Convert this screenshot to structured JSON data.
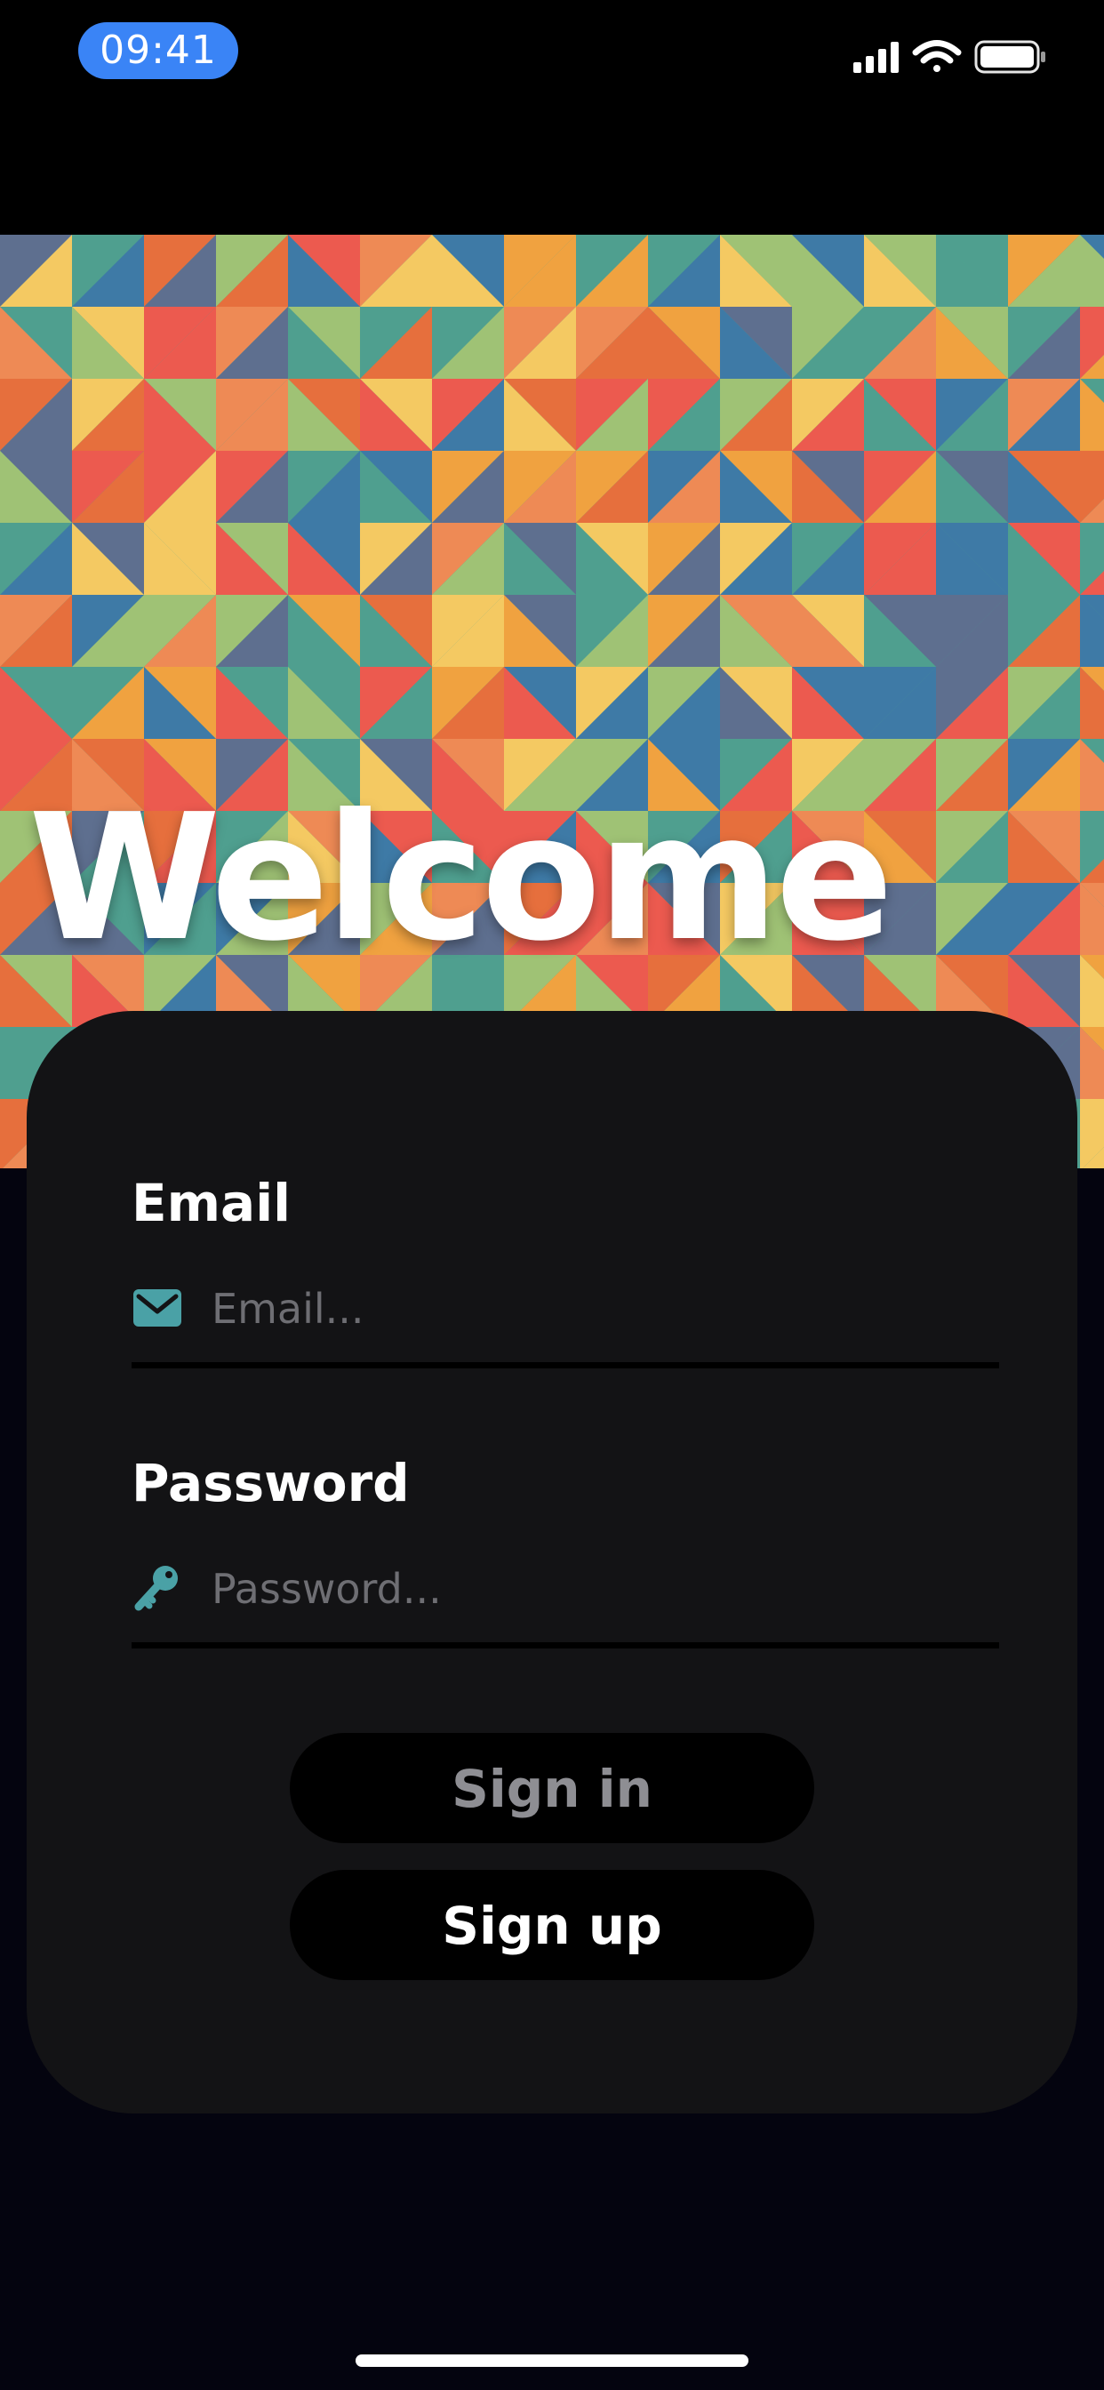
{
  "status_bar": {
    "time": "09:41",
    "icons": [
      "cellular-signal-icon",
      "wifi-icon",
      "battery-icon"
    ],
    "pill_color": "#3a84f6"
  },
  "hero": {
    "title": "Welcome",
    "pattern_colors": [
      "#ec5a4f",
      "#f4c962",
      "#9fc275",
      "#4f9f8f",
      "#3e7aa6",
      "#5e6f8f",
      "#ee8a55",
      "#e66f3d",
      "#f0a240"
    ]
  },
  "form": {
    "email": {
      "label": "Email",
      "placeholder": "Email...",
      "value": "",
      "icon": "envelope-icon"
    },
    "password": {
      "label": "Password",
      "placeholder": "Password...",
      "value": "",
      "icon": "key-icon"
    },
    "icon_color": "#4aa1a6"
  },
  "buttons": {
    "sign_in": {
      "label": "Sign in",
      "color": "#8e8e93"
    },
    "sign_up": {
      "label": "Sign up",
      "color": "#ffffff"
    }
  },
  "colors": {
    "background": "#04040f",
    "card": "#131315"
  }
}
